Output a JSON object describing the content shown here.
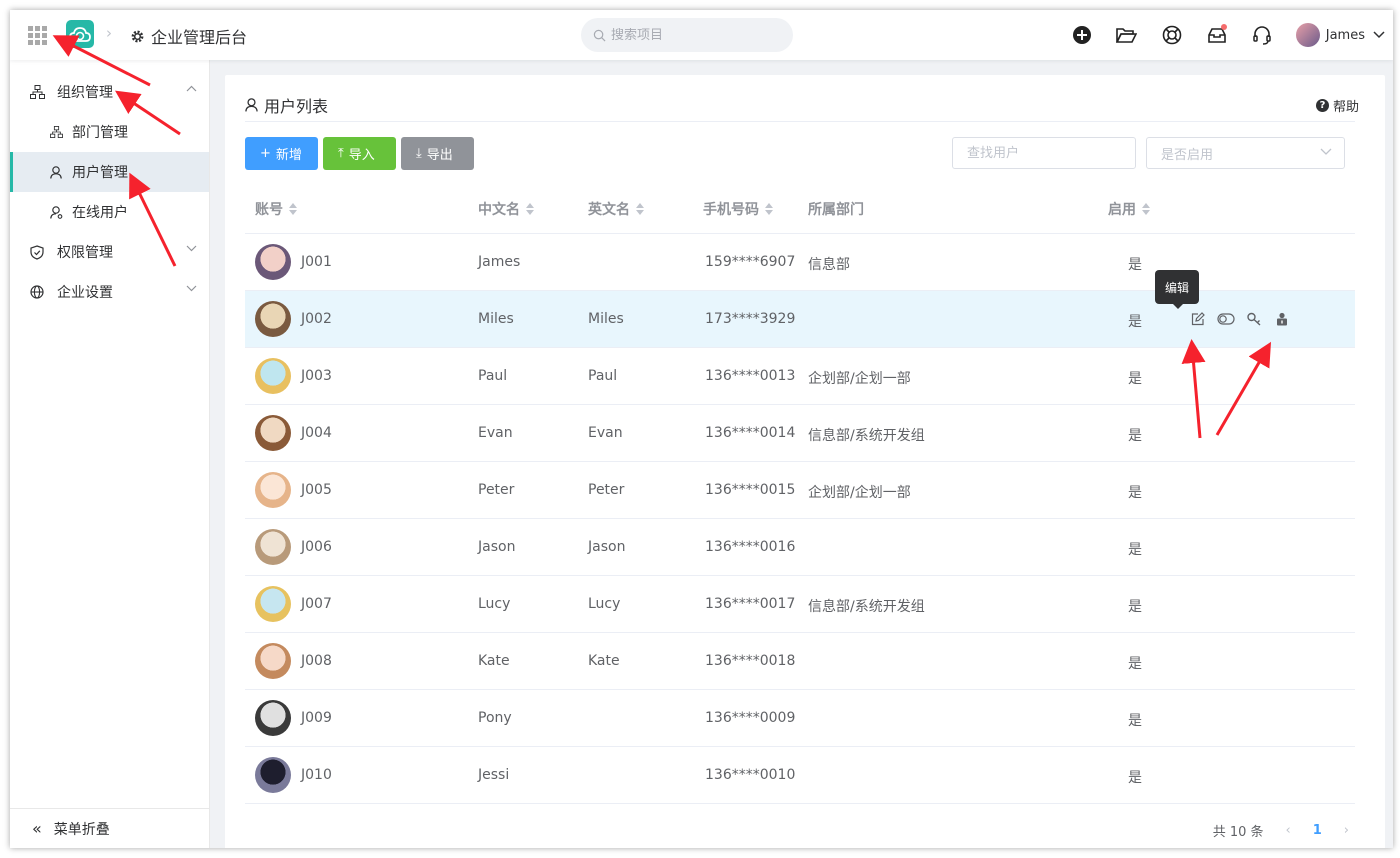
{
  "header": {
    "breadcrumb_title": "企业管理后台",
    "search_placeholder": "搜索项目",
    "user_name": "James"
  },
  "sidebar": {
    "items": [
      {
        "label": "组织管理",
        "icon": "org-icon",
        "expanded": true
      },
      {
        "label": "部门管理",
        "icon": "org-icon",
        "sub": true
      },
      {
        "label": "用户管理",
        "icon": "user-icon",
        "sub": true,
        "active": true
      },
      {
        "label": "在线用户",
        "icon": "online-user-icon",
        "sub": true
      },
      {
        "label": "权限管理",
        "icon": "shield-icon",
        "expanded": false
      },
      {
        "label": "企业设置",
        "icon": "globe-icon",
        "expanded": false
      }
    ],
    "collapse_label": "菜单折叠"
  },
  "panel": {
    "title": "用户列表",
    "help_label": "帮助"
  },
  "toolbar": {
    "add_label": "新增",
    "import_label": "导入",
    "export_label": "导出",
    "search_placeholder": "查找用户",
    "status_placeholder": "是否启用"
  },
  "table": {
    "columns": [
      "账号",
      "中文名",
      "英文名",
      "手机号码",
      "所属部门",
      "启用"
    ],
    "rows": [
      {
        "account": "J001",
        "cn": "James",
        "en": "",
        "phone": "159****6907",
        "dept": "信息部",
        "enabled": "是"
      },
      {
        "account": "J002",
        "cn": "Miles",
        "en": "Miles",
        "phone": "173****3929",
        "dept": "",
        "enabled": "是"
      },
      {
        "account": "J003",
        "cn": "Paul",
        "en": "Paul",
        "phone": "136****0013",
        "dept": "企划部/企划一部",
        "enabled": "是"
      },
      {
        "account": "J004",
        "cn": "Evan",
        "en": "Evan",
        "phone": "136****0014",
        "dept": "信息部/系统开发组",
        "enabled": "是"
      },
      {
        "account": "J005",
        "cn": "Peter",
        "en": "Peter",
        "phone": "136****0015",
        "dept": "企划部/企划一部",
        "enabled": "是"
      },
      {
        "account": "J006",
        "cn": "Jason",
        "en": "Jason",
        "phone": "136****0016",
        "dept": "",
        "enabled": "是"
      },
      {
        "account": "J007",
        "cn": "Lucy",
        "en": "Lucy",
        "phone": "136****0017",
        "dept": "信息部/系统开发组",
        "enabled": "是"
      },
      {
        "account": "J008",
        "cn": "Kate",
        "en": "Kate",
        "phone": "136****0018",
        "dept": "",
        "enabled": "是"
      },
      {
        "account": "J009",
        "cn": "Pony",
        "en": "",
        "phone": "136****0009",
        "dept": "",
        "enabled": "是"
      },
      {
        "account": "J010",
        "cn": "Jessi",
        "en": "",
        "phone": "136****0010",
        "dept": "",
        "enabled": "是"
      }
    ],
    "tooltip": "编辑"
  },
  "pager": {
    "total": "共 10 条",
    "current": "1"
  },
  "colors": {
    "primary": "#409eff",
    "success": "#67c23a",
    "info": "#909399",
    "brand": "#26b8a7",
    "annotation": "#f5222d"
  }
}
